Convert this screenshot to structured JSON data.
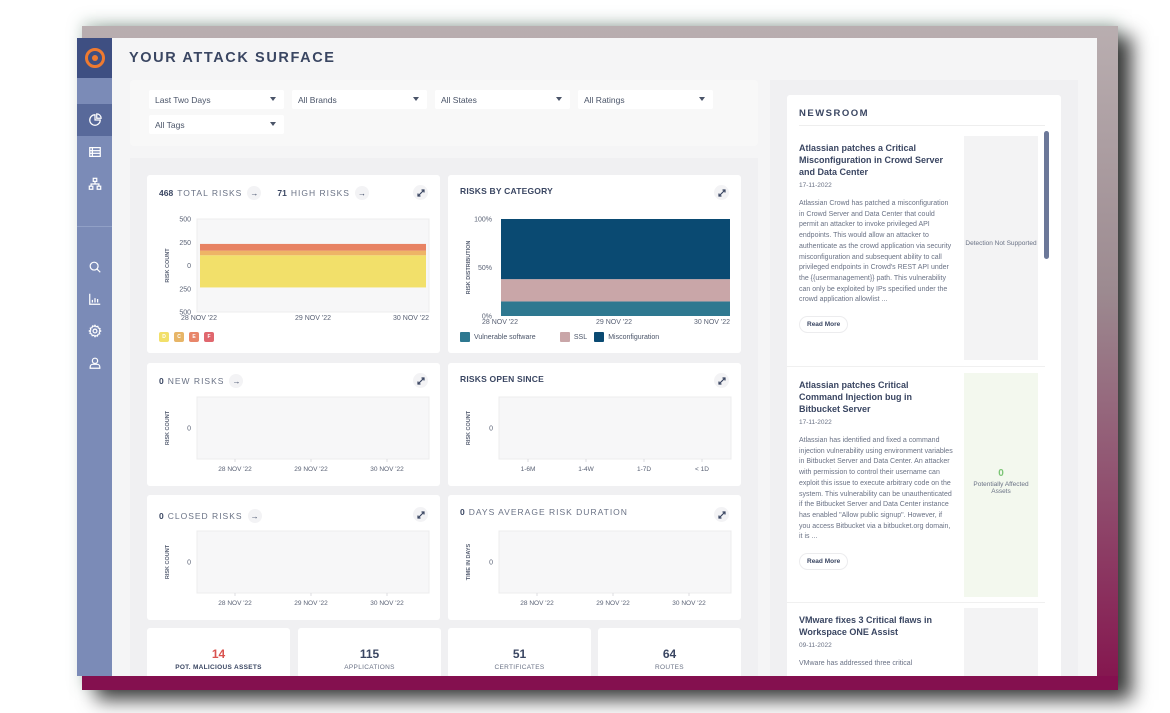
{
  "page": {
    "title": "YOUR ATTACK SURFACE"
  },
  "sidebar": {
    "logo": "logo-icon",
    "items": [
      {
        "name": "dashboard",
        "icon": "pie-chart-icon",
        "active": true
      },
      {
        "name": "inventory",
        "icon": "table-icon",
        "active": false
      },
      {
        "name": "network",
        "icon": "sitemap-icon",
        "active": false
      },
      {
        "name": "search",
        "icon": "search-icon",
        "active": false
      },
      {
        "name": "reports",
        "icon": "bar-chart-icon",
        "active": false
      },
      {
        "name": "settings",
        "icon": "gear-icon",
        "active": false
      },
      {
        "name": "profile",
        "icon": "user-icon",
        "active": false
      }
    ]
  },
  "filters": {
    "period": "Last Two Days",
    "brands": "All Brands",
    "states": "All States",
    "ratings": "All Ratings",
    "tags": "All Tags"
  },
  "cards": {
    "total_risks": {
      "count": "468",
      "label": "TOTAL RISKS",
      "high_count": "71",
      "high_label": "HIGH RISKS",
      "arrow": "→"
    },
    "new_risks": {
      "count": "0",
      "label": "NEW RISKS",
      "arrow": "→"
    },
    "risks_open_since": {
      "label": "RISKS OPEN SINCE"
    },
    "closed_risks": {
      "count": "0",
      "label": "CLOSED RISKS",
      "arrow": "→"
    },
    "avg_duration": {
      "count": "0",
      "label": "DAYS AVERAGE RISK DURATION"
    }
  },
  "chart_data": [
    {
      "id": "total-risks-chart",
      "type": "area",
      "title": "TOTAL RISKS",
      "ylabel": "RISK COUNT",
      "xlabel": "",
      "x": [
        "28 NOV '22",
        "29 NOV '22",
        "30 NOV '22"
      ],
      "y_ticks": [
        "500",
        "250",
        "0",
        "250",
        "500"
      ],
      "ylim": [
        -500,
        500
      ],
      "series": [
        {
          "name": "D",
          "color": "#f2e06a",
          "values": [
            -236,
            -236,
            -236
          ],
          "base": [
            110,
            110,
            110
          ]
        },
        {
          "name": "C",
          "color": "#eeb466",
          "values": [
            110,
            110,
            110
          ],
          "base": [
            160,
            160,
            160
          ]
        },
        {
          "name": "E",
          "color": "#e88363",
          "values": [
            160,
            160,
            160
          ],
          "base": [
            232,
            232,
            232
          ]
        }
      ],
      "legend": [
        {
          "label": "D",
          "color": "#f2e06a"
        },
        {
          "label": "C",
          "color": "#e7b567"
        },
        {
          "label": "E",
          "color": "#e8866a"
        },
        {
          "label": "F",
          "color": "#e0676e"
        }
      ],
      "legend_position": "bottom-left"
    },
    {
      "id": "risks-by-category-chart",
      "type": "area",
      "title": "RISKS BY CATEGORY",
      "ylabel": "RISK DISTRIBUTION",
      "xlabel": "",
      "x": [
        "28 NOV '22",
        "29 NOV '22",
        "30 NOV '22"
      ],
      "y_ticks": [
        "100%",
        "50%",
        "0%"
      ],
      "ylim": [
        0,
        100
      ],
      "series": [
        {
          "name": "Vulnerable software",
          "color": "#2e7890",
          "values": [
            15,
            15,
            15
          ]
        },
        {
          "name": "SSL",
          "color": "#c9a6a8",
          "values": [
            23,
            23,
            23
          ]
        },
        {
          "name": "Misconfiguration",
          "color": "#0a4a72",
          "values": [
            62,
            62,
            62
          ]
        }
      ],
      "legend_position": "bottom-left"
    },
    {
      "id": "new-risks-chart",
      "type": "line",
      "ylabel": "RISK COUNT",
      "x": [
        "28 NOV '22",
        "29 NOV '22",
        "30 NOV '22"
      ],
      "y_ticks": [
        "0"
      ],
      "series": []
    },
    {
      "id": "risks-open-since-chart",
      "type": "bar",
      "ylabel": "RISK COUNT",
      "categories": [
        "1-6M",
        "1-4W",
        "1-7D",
        "< 1D"
      ],
      "y_ticks": [
        "0"
      ],
      "values": [
        0,
        0,
        0,
        0
      ]
    },
    {
      "id": "closed-risks-chart",
      "type": "line",
      "ylabel": "RISK COUNT",
      "x": [
        "28 NOV '22",
        "29 NOV '22",
        "30 NOV '22"
      ],
      "y_ticks": [
        "0"
      ],
      "series": []
    },
    {
      "id": "avg-duration-chart",
      "type": "line",
      "ylabel": "TIME IN DAYS",
      "x": [
        "28 NOV '22",
        "29 NOV '22",
        "30 NOV '22"
      ],
      "y_ticks": [
        "0"
      ],
      "series": []
    }
  ],
  "stats": [
    {
      "value": "14",
      "label": "POT. MALICIOUS ASSETS",
      "color": "#d9534f"
    },
    {
      "value": "115",
      "label": "APPLICATIONS",
      "color": "#3a4662"
    },
    {
      "value": "51",
      "label": "CERTIFICATES",
      "color": "#3a4662"
    },
    {
      "value": "64",
      "label": "ROUTES",
      "color": "#3a4662"
    }
  ],
  "newsroom": {
    "title": "NEWSROOM",
    "read_more": "Read More",
    "articles": [
      {
        "title": "Atlassian patches a Critical Misconfiguration in Crowd Server and Data Center",
        "date": "17-11-2022",
        "body": "Atlassian Crowd has patched a misconfiguration in Crowd Server and Data Center that could permit an attacker to invoke privileged API endpoints. This would allow an attacker to authenticate as the crowd application via security misconfiguration and subsequent ability to call privileged endpoints in Crowd's REST API under the {{usermanagement}} path. This vulnerability can only be exploited by IPs specified under the crowd application allowlist ...",
        "side_text": "Detection Not Supported"
      },
      {
        "title": "Atlassian patches Critical Command Injection bug in Bitbucket Server",
        "date": "17-11-2022",
        "body": "Atlassian has identified and fixed a command injection vulnerability using environment variables in Bitbucket Server and Data Center. An attacker with permission to control their username can exploit this issue to execute arbitrary code on the system. This vulnerability can be unauthenticated if the Bitbucket Server and Data Center instance has enabled \"Allow public signup\". However, if you access Bitbucket via a bitbucket.org domain, it is ...",
        "side_count": "0",
        "side_text": "Potentially Affected Assets"
      },
      {
        "title": "VMware fixes 3 Critical flaws in Workspace ONE Assist",
        "date": "09-11-2022",
        "body": "VMware has addressed three critical"
      }
    ]
  }
}
